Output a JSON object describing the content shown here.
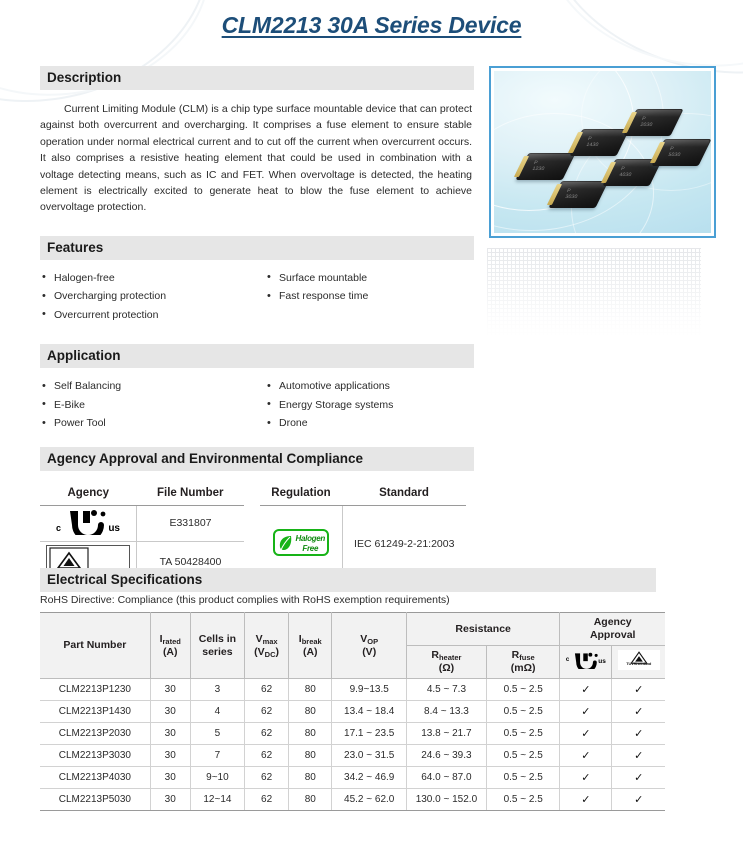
{
  "title": "CLM2213 30A Series Device",
  "sections": {
    "description": {
      "heading": "Description",
      "body": "Current Limiting Module (CLM) is a chip type surface mountable device that can protect against both overcurrent and overcharging. It comprises a fuse element to ensure stable operation under normal electrical current and to cut off the current when overcurrent occurs. It also comprises a resistive heating element that could be used in combination with a voltage detecting means, such as IC and FET. When overvoltage is detected, the heating element is electrically excited to generate heat to blow the fuse element to achieve overvoltage protection."
    },
    "features": {
      "heading": "Features",
      "left": [
        "Halogen-free",
        "Overcharging protection",
        "Overcurrent protection"
      ],
      "right": [
        "Surface mountable",
        "Fast response time"
      ]
    },
    "application": {
      "heading": "Application",
      "left": [
        "Self Balancing",
        "E-Bike",
        "Power Tool"
      ],
      "right": [
        "Automotive applications",
        "Energy Storage systems",
        "Drone"
      ]
    },
    "agency": {
      "heading": "Agency Approval and Environmental Compliance",
      "agency_table": {
        "headers": [
          "Agency",
          "File Number"
        ],
        "rows": [
          {
            "logo": "ul-cul-us-logo",
            "file_number": "E331807"
          },
          {
            "logo": "tuv-rheinland-logo",
            "file_number": "TA 50428400"
          }
        ]
      },
      "regulation_table": {
        "headers": [
          "Regulation",
          "Standard"
        ],
        "rows": [
          {
            "logo": "halogen-free-logo",
            "standard": "IEC 61249-2-21:2003"
          }
        ]
      },
      "rohs_note": "RoHS Directive: Compliance (this product complies with RoHS exemption requirements)"
    },
    "electrical": {
      "heading": "Electrical Specifications"
    }
  },
  "logos": {
    "halogen_free_line1": "Halogen",
    "halogen_free_line2": "Free",
    "ul_c": "c",
    "ul_us": "us",
    "tuv_certified": "CERTIFIED",
    "tuv_word": "TUVRheinland"
  },
  "product_image": {
    "name": "clm2213-product-photo",
    "chips": [
      {
        "label_line1": "P",
        "label_line2": "1230"
      },
      {
        "label_line1": "P",
        "label_line2": "1430"
      },
      {
        "label_line1": "P",
        "label_line2": "2030"
      },
      {
        "label_line1": "P",
        "label_line2": "3030"
      },
      {
        "label_line1": "P",
        "label_line2": "4030"
      },
      {
        "label_line1": "P",
        "label_line2": "5030"
      }
    ]
  },
  "spec_table": {
    "headers": {
      "part_number": "Part Number",
      "i_rated_main": "I",
      "i_rated_sub": "rated",
      "i_rated_unit": "(A)",
      "cells_line1": "Cells in",
      "cells_line2": "series",
      "vmax_main": "V",
      "vmax_sub": "max",
      "vmax_unit_main": "(V",
      "vmax_unit_sub": "DC",
      "vmax_unit_end": ")",
      "ibreak_main": "I",
      "ibreak_sub": "break",
      "ibreak_unit": "(A)",
      "vop_main": "V",
      "vop_sub": "OP",
      "vop_unit": "(V)",
      "resistance": "Resistance",
      "rheater_main": "R",
      "rheater_sub": "heater",
      "rheater_unit": "(Ω)",
      "rfuse_main": "R",
      "rfuse_sub": "fuse",
      "rfuse_unit": "(mΩ)",
      "agency_line1": "Agency",
      "agency_line2": "Approval"
    },
    "rows": [
      {
        "part_number": "CLM2213P1230",
        "i_rated": "30",
        "cells": "3",
        "vmax": "62",
        "ibreak": "80",
        "vop": "9.9~13.5",
        "rheater": "4.5 ~ 7.3",
        "rfuse": "0.5 ~ 2.5",
        "ul": "✓",
        "tuv": "✓"
      },
      {
        "part_number": "CLM2213P1430",
        "i_rated": "30",
        "cells": "4",
        "vmax": "62",
        "ibreak": "80",
        "vop": "13.4 ~ 18.4",
        "rheater": "8.4 ~ 13.3",
        "rfuse": "0.5 ~ 2.5",
        "ul": "✓",
        "tuv": "✓"
      },
      {
        "part_number": "CLM2213P2030",
        "i_rated": "30",
        "cells": "5",
        "vmax": "62",
        "ibreak": "80",
        "vop": "17.1 ~ 23.5",
        "rheater": "13.8 ~ 21.7",
        "rfuse": "0.5 ~ 2.5",
        "ul": "✓",
        "tuv": "✓"
      },
      {
        "part_number": "CLM2213P3030",
        "i_rated": "30",
        "cells": "7",
        "vmax": "62",
        "ibreak": "80",
        "vop": "23.0 ~ 31.5",
        "rheater": "24.6 ~ 39.3",
        "rfuse": "0.5 ~ 2.5",
        "ul": "✓",
        "tuv": "✓"
      },
      {
        "part_number": "CLM2213P4030",
        "i_rated": "30",
        "cells": "9~10",
        "vmax": "62",
        "ibreak": "80",
        "vop": "34.2 ~ 46.9",
        "rheater": "64.0 ~ 87.0",
        "rfuse": "0.5 ~ 2.5",
        "ul": "✓",
        "tuv": "✓"
      },
      {
        "part_number": "CLM2213P5030",
        "i_rated": "30",
        "cells": "12~14",
        "vmax": "62",
        "ibreak": "80",
        "vop": "45.2 ~ 62.0",
        "rheater": "130.0 ~ 152.0",
        "rfuse": "0.5 ~ 2.5",
        "ul": "✓",
        "tuv": "✓"
      }
    ]
  },
  "colors": {
    "title_blue": "#1d4e79",
    "section_bar_gray": "#e6e6e6",
    "panel_border_blue": "#4a9fd4",
    "halogen_green": "#17b317"
  }
}
